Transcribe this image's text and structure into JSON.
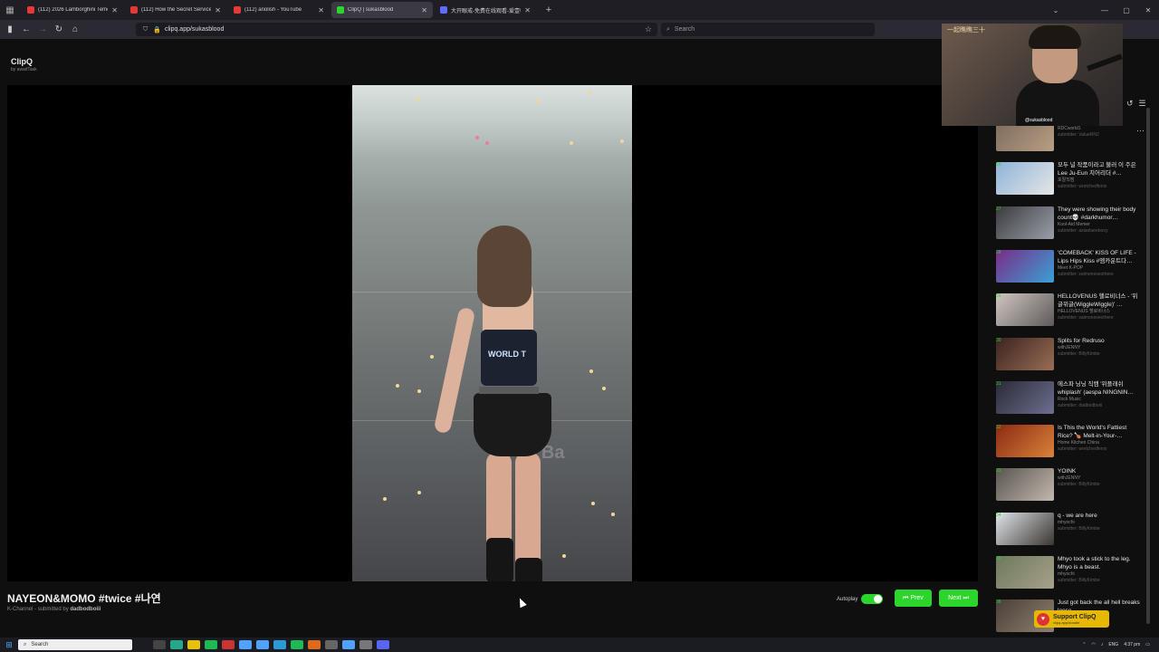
{
  "browser": {
    "tabs": [
      {
        "label": "(112) 2026 Lamborghini Temeri",
        "fav": "#e53935"
      },
      {
        "label": "(112) How the Secret Service A",
        "fav": "#e53935"
      },
      {
        "label": "(112) anolish - YouTube",
        "fav": "#e53935"
      },
      {
        "label": "ClipQ | sukasblood",
        "fav": "#2bd52b"
      },
      {
        "label": "大开眼戒-免费在线观看-爱壹帆",
        "fav": "#5f6cff"
      }
    ],
    "url": "clipq.app/sukasblood",
    "search_placeholder": "Search"
  },
  "app": {
    "brand": "ClipQ",
    "brand_sub": "by awaitTask"
  },
  "webcam": {
    "overlay_text": "一起瞧瞧三十",
    "name_text": "@sukasblood"
  },
  "video": {
    "title": "NAYEON&MOMO #twice #나연",
    "channel": "K-Channel",
    "submitted_by_label": "- submitted by",
    "submitter": "dadbodboiii",
    "shirt_text": "WORLD T",
    "stage_text": "os Ba"
  },
  "controls": {
    "autoplay_label": "Autoplay",
    "autoplay_on": true,
    "prev_label": "⏮ Prev",
    "next_label": "Next ⏭"
  },
  "queue": [
    {
      "num": "",
      "title": "Yapper Melon",
      "channel": "RDCworld1",
      "sub": "submitter: ValueRN2",
      "colors": [
        "#7c6a5d",
        "#b89e84"
      ]
    },
    {
      "num": "26",
      "title": "모두 널 작품이라고 불러 이 주은Lee Ju-Eun 치어리더 #…",
      "channel": "포랄직캠",
      "sub": "submitter: wretchedfenix",
      "colors": [
        "#8fb3d9",
        "#e6e6e6"
      ]
    },
    {
      "num": "27",
      "title": "They were showing their body count💀 #darkhumor…",
      "channel": "Kool-Aid Memer",
      "sub": "submitter: asianlaeebooy",
      "colors": [
        "#3b3b3f",
        "#9aa0a8"
      ]
    },
    {
      "num": "28",
      "title": "'COMEBACK' KISS OF LIFE - Lips Hips Kiss #엠카운트다…",
      "channel": "Meet K-POP",
      "sub": "submitter: saimoneseothere",
      "colors": [
        "#7a2c86",
        "#3aa0d6"
      ]
    },
    {
      "num": "29",
      "title": "HELLOVENUS 헬로비너스 - '위글위글(WiggleWiggle)' …",
      "channel": "HELLOVENUS 헬로비너스",
      "sub": "submitter: saimoneseothere",
      "colors": [
        "#cfc6c0",
        "#5e5a5a"
      ]
    },
    {
      "num": "30",
      "title": "Splits for Redruso",
      "channel": "withJENNY",
      "sub": "submitter: BillyKimbe",
      "colors": [
        "#3a2420",
        "#9a6d55"
      ]
    },
    {
      "num": "31",
      "title": "에스파 닝닝 직캠 '위플래쉬 whiplash' (aespa NINGNIN…",
      "channel": "Rock Music",
      "sub": "submitter: dadbodboiii",
      "colors": [
        "#2a2a36",
        "#6c6f90"
      ]
    },
    {
      "num": "32",
      "title": "Is This the World's Fattiest Rice? 🍗 Melt-in-Your-…",
      "channel": "Home Kitchen China",
      "sub": "submitter: wretchedfenix",
      "colors": [
        "#8b2a12",
        "#d9823a"
      ]
    },
    {
      "num": "33",
      "title": "YOINK",
      "channel": "withJENNY",
      "sub": "submitter: BillyKimbe",
      "colors": [
        "#5a5550",
        "#c2b8ae"
      ]
    },
    {
      "num": "34",
      "title": "q - we are here",
      "channel": "mhyochi",
      "sub": "submitter: BillyKimbe",
      "colors": [
        "#dfe5ea",
        "#3b3530"
      ]
    },
    {
      "num": "35",
      "title": "Mhyo took a stick to the leg. Mhyo is a beast.",
      "channel": "mhyochi",
      "sub": "submitter: BillyKimbe",
      "colors": [
        "#6c7a5c",
        "#a7a08a"
      ]
    },
    {
      "num": "36",
      "title": "Just got back the all hell breaks loose.",
      "channel": "",
      "sub": "",
      "colors": [
        "#4a4038",
        "#8e8070"
      ]
    }
  ],
  "support": {
    "label": "Support ClipQ",
    "url": "clipq.app/donate"
  },
  "taskbar": {
    "search_placeholder": "Search",
    "lang": "ENG",
    "time": "4:37 pm"
  }
}
